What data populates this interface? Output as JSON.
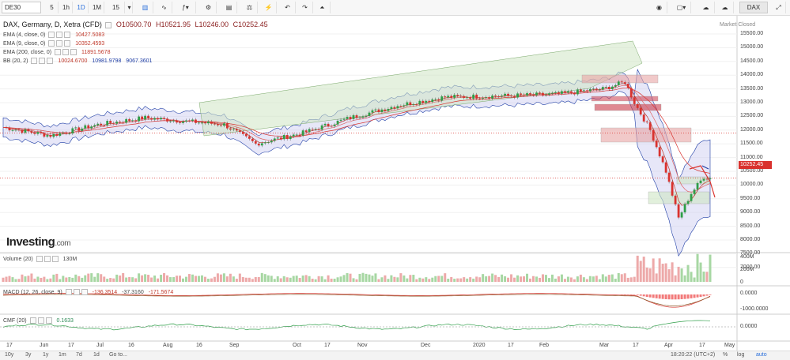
{
  "toolbar": {
    "symbol": "DE30",
    "intervals": [
      "5",
      "1h",
      "1D",
      "1M",
      "15"
    ],
    "active_interval": "1D",
    "dax_label": "DAX"
  },
  "chart_header": {
    "title": "DAX, Germany, D, Xetra (CFD)",
    "open": "O10500.70",
    "high": "H10521.95",
    "low": "L10246.00",
    "close": "C10252.45",
    "market_status": "Market Closed"
  },
  "legend": [
    {
      "label": "EMA (4, close, 0)",
      "value": "10427.5083",
      "color": "#d9322e"
    },
    {
      "label": "EMA (9, close, 0)",
      "value": "10352.4593",
      "color": "#d9322e"
    },
    {
      "label": "EMA (200, close, 0)",
      "value": "11891.5678",
      "color": "#d9322e"
    },
    {
      "label": "BB (20, 2)",
      "value": "10024.6700",
      "value2": "10981.9798",
      "value3": "9067.3601",
      "color": "#1f3ea6"
    }
  ],
  "price_axis": [
    "15500.00",
    "15000.00",
    "14500.00",
    "14000.00",
    "13500.00",
    "13000.00",
    "12500.00",
    "12000.00",
    "11500.00",
    "11000.00",
    "10500.00",
    "10000.00",
    "9500.00",
    "9000.00",
    "8500.00",
    "8000.00",
    "7500.00",
    "7000.00"
  ],
  "last_price": "10252.45",
  "logo": {
    "brand": "Investing",
    "suffix": ".com"
  },
  "volume_panel": {
    "label": "Volume (20)",
    "value": "130M",
    "axis": [
      "400M",
      "200M",
      "0"
    ]
  },
  "macd_panel": {
    "label": "MACD (12, 26, close, 9)",
    "v1": "-136.3514",
    "v2": "-37.3160",
    "v3": "-171.5674",
    "axis": [
      "0.0000",
      "-1000.0000"
    ]
  },
  "cmf_panel": {
    "label": "CMF (20)",
    "value": "0.1633",
    "axis": [
      "0.0000"
    ]
  },
  "x_axis": [
    "17",
    "Jun",
    "17",
    "Jul",
    "16",
    "Aug",
    "16",
    "Sep",
    "Oct",
    "17",
    "Nov",
    "Dec",
    "2020",
    "17",
    "Feb",
    "Mar",
    "17",
    "Apr",
    "17",
    "May"
  ],
  "bottom_bar": {
    "ranges": [
      "10y",
      "3y",
      "1y",
      "1m",
      "7d",
      "1d",
      "Go to..."
    ],
    "time": "18:20:22 (UTC+2)",
    "options": [
      "%",
      "log",
      "auto"
    ]
  },
  "colors": {
    "up": "#2e9e48",
    "down": "#d9322e",
    "band": "#c9c9f0",
    "channel": "#cfe6c4",
    "zone_red": "#e8a5a5",
    "zone_green": "#cfe6c4"
  }
}
